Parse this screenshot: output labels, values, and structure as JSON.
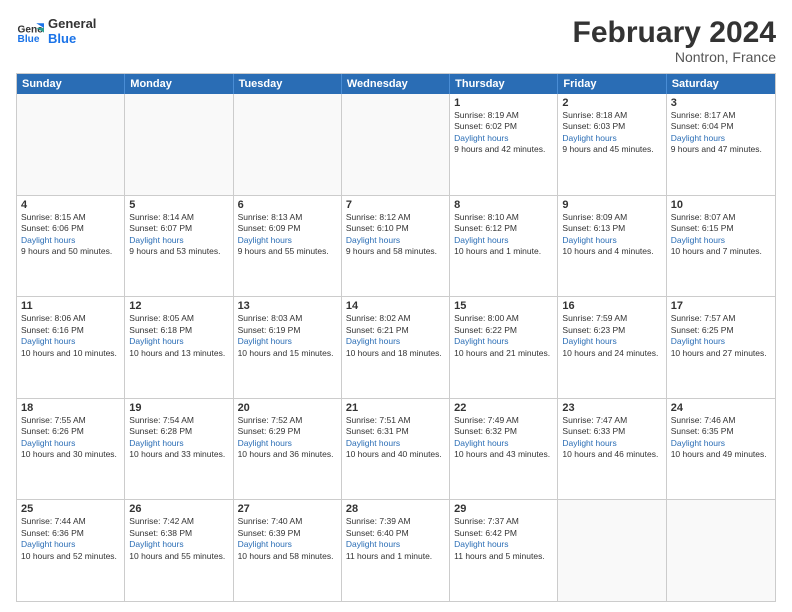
{
  "logo": {
    "text_general": "General",
    "text_blue": "Blue"
  },
  "title": "February 2024",
  "subtitle": "Nontron, France",
  "days_of_week": [
    "Sunday",
    "Monday",
    "Tuesday",
    "Wednesday",
    "Thursday",
    "Friday",
    "Saturday"
  ],
  "weeks": [
    [
      {
        "day": "",
        "info": ""
      },
      {
        "day": "",
        "info": ""
      },
      {
        "day": "",
        "info": ""
      },
      {
        "day": "",
        "info": ""
      },
      {
        "day": "1",
        "sunrise": "Sunrise: 8:19 AM",
        "sunset": "Sunset: 6:02 PM",
        "daylight": "Daylight: 9 hours and 42 minutes."
      },
      {
        "day": "2",
        "sunrise": "Sunrise: 8:18 AM",
        "sunset": "Sunset: 6:03 PM",
        "daylight": "Daylight: 9 hours and 45 minutes."
      },
      {
        "day": "3",
        "sunrise": "Sunrise: 8:17 AM",
        "sunset": "Sunset: 6:04 PM",
        "daylight": "Daylight: 9 hours and 47 minutes."
      }
    ],
    [
      {
        "day": "4",
        "sunrise": "Sunrise: 8:15 AM",
        "sunset": "Sunset: 6:06 PM",
        "daylight": "Daylight: 9 hours and 50 minutes."
      },
      {
        "day": "5",
        "sunrise": "Sunrise: 8:14 AM",
        "sunset": "Sunset: 6:07 PM",
        "daylight": "Daylight: 9 hours and 53 minutes."
      },
      {
        "day": "6",
        "sunrise": "Sunrise: 8:13 AM",
        "sunset": "Sunset: 6:09 PM",
        "daylight": "Daylight: 9 hours and 55 minutes."
      },
      {
        "day": "7",
        "sunrise": "Sunrise: 8:12 AM",
        "sunset": "Sunset: 6:10 PM",
        "daylight": "Daylight: 9 hours and 58 minutes."
      },
      {
        "day": "8",
        "sunrise": "Sunrise: 8:10 AM",
        "sunset": "Sunset: 6:12 PM",
        "daylight": "Daylight: 10 hours and 1 minute."
      },
      {
        "day": "9",
        "sunrise": "Sunrise: 8:09 AM",
        "sunset": "Sunset: 6:13 PM",
        "daylight": "Daylight: 10 hours and 4 minutes."
      },
      {
        "day": "10",
        "sunrise": "Sunrise: 8:07 AM",
        "sunset": "Sunset: 6:15 PM",
        "daylight": "Daylight: 10 hours and 7 minutes."
      }
    ],
    [
      {
        "day": "11",
        "sunrise": "Sunrise: 8:06 AM",
        "sunset": "Sunset: 6:16 PM",
        "daylight": "Daylight: 10 hours and 10 minutes."
      },
      {
        "day": "12",
        "sunrise": "Sunrise: 8:05 AM",
        "sunset": "Sunset: 6:18 PM",
        "daylight": "Daylight: 10 hours and 13 minutes."
      },
      {
        "day": "13",
        "sunrise": "Sunrise: 8:03 AM",
        "sunset": "Sunset: 6:19 PM",
        "daylight": "Daylight: 10 hours and 15 minutes."
      },
      {
        "day": "14",
        "sunrise": "Sunrise: 8:02 AM",
        "sunset": "Sunset: 6:21 PM",
        "daylight": "Daylight: 10 hours and 18 minutes."
      },
      {
        "day": "15",
        "sunrise": "Sunrise: 8:00 AM",
        "sunset": "Sunset: 6:22 PM",
        "daylight": "Daylight: 10 hours and 21 minutes."
      },
      {
        "day": "16",
        "sunrise": "Sunrise: 7:59 AM",
        "sunset": "Sunset: 6:23 PM",
        "daylight": "Daylight: 10 hours and 24 minutes."
      },
      {
        "day": "17",
        "sunrise": "Sunrise: 7:57 AM",
        "sunset": "Sunset: 6:25 PM",
        "daylight": "Daylight: 10 hours and 27 minutes."
      }
    ],
    [
      {
        "day": "18",
        "sunrise": "Sunrise: 7:55 AM",
        "sunset": "Sunset: 6:26 PM",
        "daylight": "Daylight: 10 hours and 30 minutes."
      },
      {
        "day": "19",
        "sunrise": "Sunrise: 7:54 AM",
        "sunset": "Sunset: 6:28 PM",
        "daylight": "Daylight: 10 hours and 33 minutes."
      },
      {
        "day": "20",
        "sunrise": "Sunrise: 7:52 AM",
        "sunset": "Sunset: 6:29 PM",
        "daylight": "Daylight: 10 hours and 36 minutes."
      },
      {
        "day": "21",
        "sunrise": "Sunrise: 7:51 AM",
        "sunset": "Sunset: 6:31 PM",
        "daylight": "Daylight: 10 hours and 40 minutes."
      },
      {
        "day": "22",
        "sunrise": "Sunrise: 7:49 AM",
        "sunset": "Sunset: 6:32 PM",
        "daylight": "Daylight: 10 hours and 43 minutes."
      },
      {
        "day": "23",
        "sunrise": "Sunrise: 7:47 AM",
        "sunset": "Sunset: 6:33 PM",
        "daylight": "Daylight: 10 hours and 46 minutes."
      },
      {
        "day": "24",
        "sunrise": "Sunrise: 7:46 AM",
        "sunset": "Sunset: 6:35 PM",
        "daylight": "Daylight: 10 hours and 49 minutes."
      }
    ],
    [
      {
        "day": "25",
        "sunrise": "Sunrise: 7:44 AM",
        "sunset": "Sunset: 6:36 PM",
        "daylight": "Daylight: 10 hours and 52 minutes."
      },
      {
        "day": "26",
        "sunrise": "Sunrise: 7:42 AM",
        "sunset": "Sunset: 6:38 PM",
        "daylight": "Daylight: 10 hours and 55 minutes."
      },
      {
        "day": "27",
        "sunrise": "Sunrise: 7:40 AM",
        "sunset": "Sunset: 6:39 PM",
        "daylight": "Daylight: 10 hours and 58 minutes."
      },
      {
        "day": "28",
        "sunrise": "Sunrise: 7:39 AM",
        "sunset": "Sunset: 6:40 PM",
        "daylight": "Daylight: 11 hours and 1 minute."
      },
      {
        "day": "29",
        "sunrise": "Sunrise: 7:37 AM",
        "sunset": "Sunset: 6:42 PM",
        "daylight": "Daylight: 11 hours and 5 minutes."
      },
      {
        "day": "",
        "info": ""
      },
      {
        "day": "",
        "info": ""
      }
    ]
  ]
}
